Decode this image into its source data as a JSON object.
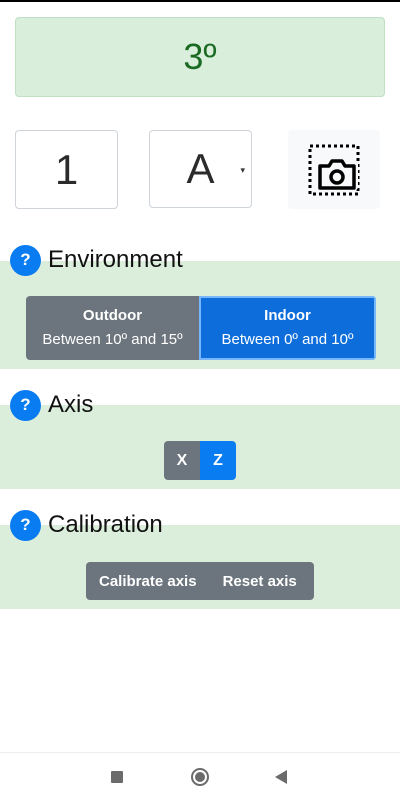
{
  "reading": {
    "value": "3º"
  },
  "controls": {
    "number": "1",
    "letter": "A",
    "letter_caret": "▾",
    "camera_icon": "screenshot-camera-icon"
  },
  "environment": {
    "title": "Environment",
    "help": "?",
    "options": [
      {
        "label": "Outdoor",
        "range": "Between 10º and 15º",
        "selected": false
      },
      {
        "label": "Indoor",
        "range": "Between 0º and 10º",
        "selected": true
      }
    ]
  },
  "axis": {
    "title": "Axis",
    "help": "?",
    "options": [
      {
        "label": "X",
        "selected": false
      },
      {
        "label": "Z",
        "selected": true
      }
    ]
  },
  "calibration": {
    "title": "Calibration",
    "help": "?",
    "calibrate_label": "Calibrate axis",
    "reset_label": "Reset axis"
  },
  "colors": {
    "band": "#dbeddb",
    "selected": "#0d6edb",
    "unselected": "#6c757d",
    "help": "#0a7cf2",
    "reading_text": "#1a6a22"
  },
  "navbar": {
    "icons": [
      "recent-apps-icon",
      "home-icon",
      "back-icon"
    ]
  }
}
